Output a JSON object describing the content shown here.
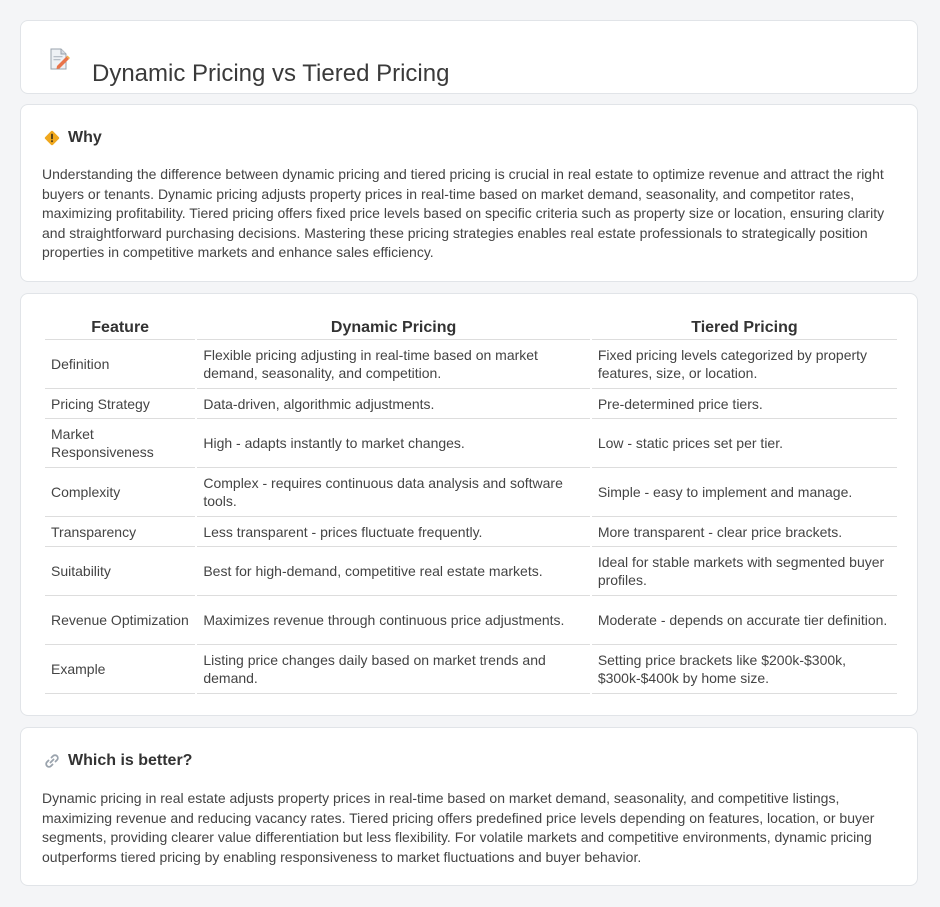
{
  "page": {
    "title": "Dynamic Pricing vs Tiered Pricing",
    "title_icon": "document-pencil-icon"
  },
  "why": {
    "heading": "Why",
    "icon": "warning-sign-icon",
    "text": "Understanding the difference between dynamic pricing and tiered pricing is crucial in real estate to optimize revenue and attract the right buyers or tenants. Dynamic pricing adjusts property prices in real-time based on market demand, seasonality, and competitor rates, maximizing profitability. Tiered pricing offers fixed price levels based on specific criteria such as property size or location, ensuring clarity and straightforward purchasing decisions. Mastering these pricing strategies enables real estate professionals to strategically position properties in competitive markets and enhance sales efficiency."
  },
  "table": {
    "headers": [
      "Feature",
      "Dynamic Pricing",
      "Tiered Pricing"
    ],
    "rows": [
      [
        "Definition",
        "Flexible pricing adjusting in real-time based on market demand, seasonality, and competition.",
        "Fixed pricing levels categorized by property features, size, or location."
      ],
      [
        "Pricing Strategy",
        "Data-driven, algorithmic adjustments.",
        "Pre-determined price tiers."
      ],
      [
        "Market Responsiveness",
        "High - adapts instantly to market changes.",
        "Low - static prices set per tier."
      ],
      [
        "Complexity",
        "Complex - requires continuous data analysis and software tools.",
        "Simple - easy to implement and manage."
      ],
      [
        "Transparency",
        "Less transparent - prices fluctuate frequently.",
        "More transparent - clear price brackets."
      ],
      [
        "Suitability",
        "Best for high-demand, competitive real estate markets.",
        "Ideal for stable markets with segmented buyer profiles."
      ],
      [
        "Revenue Optimization",
        "Maximizes revenue through continuous price adjustments.",
        "Moderate - depends on accurate tier definition."
      ],
      [
        "Example",
        "Listing price changes daily based on market trends and demand.",
        "Setting price brackets like $200k-$300k, $300k-$400k by home size."
      ]
    ]
  },
  "better": {
    "heading": "Which is better?",
    "icon": "link-icon",
    "text": "Dynamic pricing in real estate adjusts property prices in real-time based on market demand, seasonality, and competitive listings, maximizing revenue and reducing vacancy rates. Tiered pricing offers predefined price levels depending on features, location, or buyer segments, providing clearer value differentiation but less flexibility. For volatile markets and competitive environments, dynamic pricing outperforms tiered pricing by enabling responsiveness to market fluctuations and buyer behavior."
  }
}
